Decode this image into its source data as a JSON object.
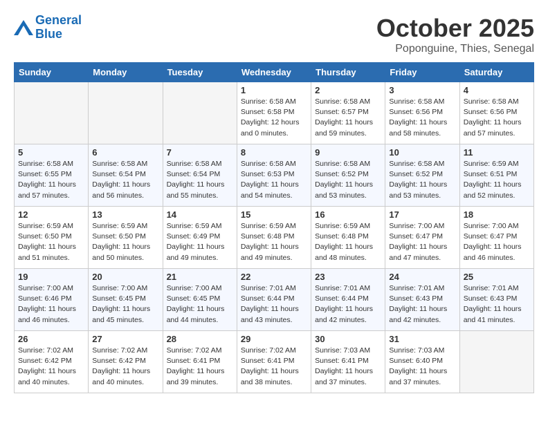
{
  "header": {
    "logo_line1": "General",
    "logo_line2": "Blue",
    "month": "October 2025",
    "location": "Poponguine, Thies, Senegal"
  },
  "weekdays": [
    "Sunday",
    "Monday",
    "Tuesday",
    "Wednesday",
    "Thursday",
    "Friday",
    "Saturday"
  ],
  "weeks": [
    [
      {
        "day": "",
        "empty": true
      },
      {
        "day": "",
        "empty": true
      },
      {
        "day": "",
        "empty": true
      },
      {
        "day": "1",
        "sunrise": "6:58 AM",
        "sunset": "6:58 PM",
        "daylight": "12 hours and 0 minutes."
      },
      {
        "day": "2",
        "sunrise": "6:58 AM",
        "sunset": "6:57 PM",
        "daylight": "11 hours and 59 minutes."
      },
      {
        "day": "3",
        "sunrise": "6:58 AM",
        "sunset": "6:56 PM",
        "daylight": "11 hours and 58 minutes."
      },
      {
        "day": "4",
        "sunrise": "6:58 AM",
        "sunset": "6:56 PM",
        "daylight": "11 hours and 57 minutes."
      }
    ],
    [
      {
        "day": "5",
        "sunrise": "6:58 AM",
        "sunset": "6:55 PM",
        "daylight": "11 hours and 57 minutes."
      },
      {
        "day": "6",
        "sunrise": "6:58 AM",
        "sunset": "6:54 PM",
        "daylight": "11 hours and 56 minutes."
      },
      {
        "day": "7",
        "sunrise": "6:58 AM",
        "sunset": "6:54 PM",
        "daylight": "11 hours and 55 minutes."
      },
      {
        "day": "8",
        "sunrise": "6:58 AM",
        "sunset": "6:53 PM",
        "daylight": "11 hours and 54 minutes."
      },
      {
        "day": "9",
        "sunrise": "6:58 AM",
        "sunset": "6:52 PM",
        "daylight": "11 hours and 53 minutes."
      },
      {
        "day": "10",
        "sunrise": "6:58 AM",
        "sunset": "6:52 PM",
        "daylight": "11 hours and 53 minutes."
      },
      {
        "day": "11",
        "sunrise": "6:59 AM",
        "sunset": "6:51 PM",
        "daylight": "11 hours and 52 minutes."
      }
    ],
    [
      {
        "day": "12",
        "sunrise": "6:59 AM",
        "sunset": "6:50 PM",
        "daylight": "11 hours and 51 minutes."
      },
      {
        "day": "13",
        "sunrise": "6:59 AM",
        "sunset": "6:50 PM",
        "daylight": "11 hours and 50 minutes."
      },
      {
        "day": "14",
        "sunrise": "6:59 AM",
        "sunset": "6:49 PM",
        "daylight": "11 hours and 49 minutes."
      },
      {
        "day": "15",
        "sunrise": "6:59 AM",
        "sunset": "6:48 PM",
        "daylight": "11 hours and 49 minutes."
      },
      {
        "day": "16",
        "sunrise": "6:59 AM",
        "sunset": "6:48 PM",
        "daylight": "11 hours and 48 minutes."
      },
      {
        "day": "17",
        "sunrise": "7:00 AM",
        "sunset": "6:47 PM",
        "daylight": "11 hours and 47 minutes."
      },
      {
        "day": "18",
        "sunrise": "7:00 AM",
        "sunset": "6:47 PM",
        "daylight": "11 hours and 46 minutes."
      }
    ],
    [
      {
        "day": "19",
        "sunrise": "7:00 AM",
        "sunset": "6:46 PM",
        "daylight": "11 hours and 46 minutes."
      },
      {
        "day": "20",
        "sunrise": "7:00 AM",
        "sunset": "6:45 PM",
        "daylight": "11 hours and 45 minutes."
      },
      {
        "day": "21",
        "sunrise": "7:00 AM",
        "sunset": "6:45 PM",
        "daylight": "11 hours and 44 minutes."
      },
      {
        "day": "22",
        "sunrise": "7:01 AM",
        "sunset": "6:44 PM",
        "daylight": "11 hours and 43 minutes."
      },
      {
        "day": "23",
        "sunrise": "7:01 AM",
        "sunset": "6:44 PM",
        "daylight": "11 hours and 42 minutes."
      },
      {
        "day": "24",
        "sunrise": "7:01 AM",
        "sunset": "6:43 PM",
        "daylight": "11 hours and 42 minutes."
      },
      {
        "day": "25",
        "sunrise": "7:01 AM",
        "sunset": "6:43 PM",
        "daylight": "11 hours and 41 minutes."
      }
    ],
    [
      {
        "day": "26",
        "sunrise": "7:02 AM",
        "sunset": "6:42 PM",
        "daylight": "11 hours and 40 minutes."
      },
      {
        "day": "27",
        "sunrise": "7:02 AM",
        "sunset": "6:42 PM",
        "daylight": "11 hours and 40 minutes."
      },
      {
        "day": "28",
        "sunrise": "7:02 AM",
        "sunset": "6:41 PM",
        "daylight": "11 hours and 39 minutes."
      },
      {
        "day": "29",
        "sunrise": "7:02 AM",
        "sunset": "6:41 PM",
        "daylight": "11 hours and 38 minutes."
      },
      {
        "day": "30",
        "sunrise": "7:03 AM",
        "sunset": "6:41 PM",
        "daylight": "11 hours and 37 minutes."
      },
      {
        "day": "31",
        "sunrise": "7:03 AM",
        "sunset": "6:40 PM",
        "daylight": "11 hours and 37 minutes."
      },
      {
        "day": "",
        "empty": true
      }
    ]
  ]
}
